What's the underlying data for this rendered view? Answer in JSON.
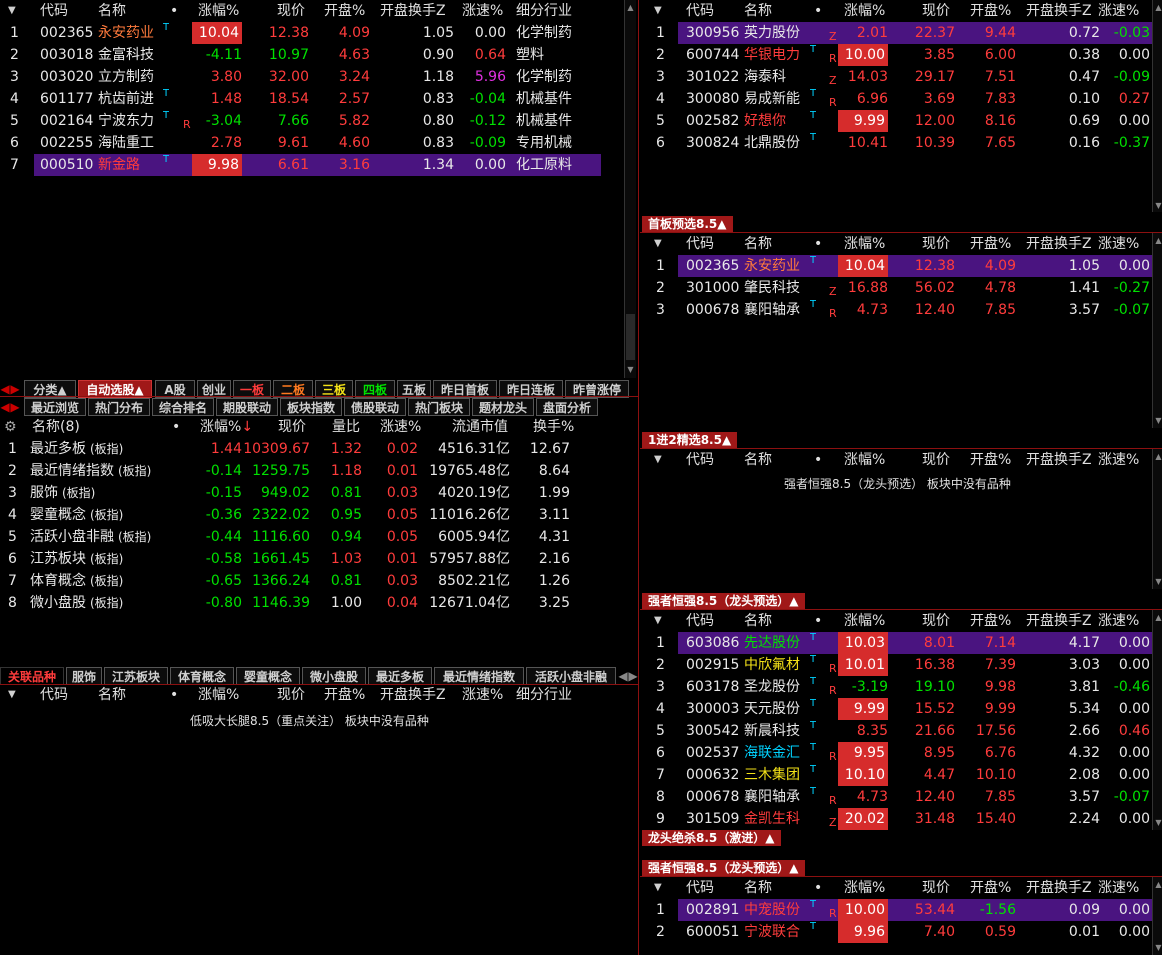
{
  "colors": {
    "red": "#ff3c3c",
    "green": "#00e000",
    "purple": "#4a1480",
    "box_red": "#d62c2c",
    "tab_red": "#a01818"
  },
  "icons": {
    "sort_toggle": "triangle-down-icon",
    "settings": "gear-icon",
    "scroll_up": "triangle-up-icon",
    "scroll_down": "triangle-down-icon"
  },
  "top_left": {
    "headers": [
      "代码",
      "名称",
      "•",
      "涨幅%",
      "现价",
      "开盘%",
      "开盘换手Z",
      "涨速%",
      "细分行业"
    ],
    "rows": [
      {
        "no": "1",
        "code": "002365",
        "name": "永安药业",
        "nc": "orange",
        "m": "",
        "t": "T",
        "chg": "10.04",
        "box": true,
        "price": "12.38",
        "open": "4.09",
        "turn": "1.05",
        "speed": "0.00",
        "ind": "化学制药",
        "pc": "red",
        "oc": "red",
        "sc": "white",
        "cc": "white"
      },
      {
        "no": "2",
        "code": "003018",
        "name": "金富科技",
        "nc": "white",
        "m": "",
        "t": "",
        "chg": "-4.11",
        "box": false,
        "price": "10.97",
        "open": "4.63",
        "turn": "0.90",
        "speed": "0.64",
        "ind": "塑料",
        "pc": "green",
        "oc": "red",
        "sc": "red",
        "cc": "green"
      },
      {
        "no": "3",
        "code": "003020",
        "name": "立方制药",
        "nc": "white",
        "m": "",
        "t": "",
        "chg": "3.80",
        "box": false,
        "price": "32.00",
        "open": "3.24",
        "turn": "1.18",
        "speed": "5.96",
        "ind": "化学制药",
        "pc": "red",
        "oc": "red",
        "sc": "magenta",
        "cc": "red"
      },
      {
        "no": "4",
        "code": "601177",
        "name": "杭齿前进",
        "nc": "white",
        "m": "",
        "t": "T",
        "chg": "1.48",
        "box": false,
        "price": "18.54",
        "open": "2.57",
        "turn": "0.83",
        "speed": "-0.04",
        "ind": "机械基件",
        "pc": "red",
        "oc": "red",
        "sc": "green",
        "cc": "red"
      },
      {
        "no": "5",
        "code": "002164",
        "name": "宁波东力",
        "nc": "white",
        "m": "R",
        "t": "T",
        "chg": "-3.04",
        "box": false,
        "price": "7.66",
        "open": "5.82",
        "turn": "0.80",
        "speed": "-0.12",
        "ind": "机械基件",
        "pc": "green",
        "oc": "red",
        "sc": "green",
        "cc": "green"
      },
      {
        "no": "6",
        "code": "002255",
        "name": "海陆重工",
        "nc": "white",
        "m": "",
        "t": "",
        "chg": "2.78",
        "box": false,
        "price": "9.61",
        "open": "4.60",
        "turn": "0.83",
        "speed": "-0.09",
        "ind": "专用机械",
        "pc": "red",
        "oc": "red",
        "sc": "green",
        "cc": "red"
      },
      {
        "no": "7",
        "code": "000510",
        "name": "新金路",
        "nc": "red",
        "m": "",
        "t": "T",
        "chg": "9.98",
        "box": true,
        "price": "6.61",
        "open": "3.16",
        "turn": "1.34",
        "speed": "0.00",
        "ind": "化工原料",
        "pc": "red",
        "oc": "red",
        "sc": "white",
        "cc": "white",
        "sel": true
      }
    ]
  },
  "tabs1": [
    "分类▲",
    "自动选股▲",
    "A股",
    "创业",
    "一板",
    "二板",
    "三板",
    "四板",
    "五板",
    "昨日首板",
    "昨日连板",
    "昨曾涨停"
  ],
  "tabs2": [
    "最近浏览",
    "热门分布",
    "综合排名",
    "期股联动",
    "板块指数",
    "债股联动",
    "热门板块",
    "题材龙头",
    "盘面分析"
  ],
  "sector": {
    "headers": [
      "名称(8)",
      "•",
      "涨幅%",
      "现价",
      "量比",
      "涨速%",
      "流通市值",
      "换手%"
    ],
    "rows": [
      {
        "no": "1",
        "name": "最近多板",
        "tag": "(板指)",
        "chg": "1.44",
        "price": "10309.67",
        "vr": "1.32",
        "speed": "0.02",
        "cap": "4516.31亿",
        "turn": "12.67",
        "cc": "red",
        "vc": "red"
      },
      {
        "no": "2",
        "name": "最近情绪指数",
        "tag": "(板指)",
        "chg": "-0.14",
        "price": "1259.75",
        "vr": "1.18",
        "speed": "0.01",
        "cap": "19765.48亿",
        "turn": "8.64",
        "cc": "green",
        "vc": "red"
      },
      {
        "no": "3",
        "name": "服饰",
        "tag": "(板指)",
        "chg": "-0.15",
        "price": "949.02",
        "vr": "0.81",
        "speed": "0.03",
        "cap": "4020.19亿",
        "turn": "1.99",
        "cc": "green",
        "vc": "green"
      },
      {
        "no": "4",
        "name": "婴童概念",
        "tag": "(板指)",
        "chg": "-0.36",
        "price": "2322.02",
        "vr": "0.95",
        "speed": "0.05",
        "cap": "11016.26亿",
        "turn": "3.11",
        "cc": "green",
        "vc": "green"
      },
      {
        "no": "5",
        "name": "活跃小盘非融",
        "tag": "(板指)",
        "chg": "-0.44",
        "price": "1116.60",
        "vr": "0.94",
        "speed": "0.05",
        "cap": "6005.94亿",
        "turn": "4.31",
        "cc": "green",
        "vc": "green"
      },
      {
        "no": "6",
        "name": "江苏板块",
        "tag": "(板指)",
        "chg": "-0.58",
        "price": "1661.45",
        "vr": "1.03",
        "speed": "0.01",
        "cap": "57957.88亿",
        "turn": "2.16",
        "cc": "green",
        "vc": "red"
      },
      {
        "no": "7",
        "name": "体育概念",
        "tag": "(板指)",
        "chg": "-0.65",
        "price": "1366.24",
        "vr": "0.81",
        "speed": "0.03",
        "cap": "8502.21亿",
        "turn": "1.26",
        "cc": "green",
        "vc": "green"
      },
      {
        "no": "8",
        "name": "微小盘股",
        "tag": "(板指)",
        "chg": "-0.80",
        "price": "1146.39",
        "vr": "1.00",
        "speed": "0.04",
        "cap": "12671.04亿",
        "turn": "3.25",
        "cc": "green",
        "vc": "white"
      }
    ]
  },
  "tabs3": [
    "关联品种",
    "服饰",
    "江苏板块",
    "体育概念",
    "婴童概念",
    "微小盘股",
    "最近多板",
    "最近情绪指数",
    "活跃小盘非融"
  ],
  "bottom_left": {
    "headers": [
      "代码",
      "名称",
      "•",
      "涨幅%",
      "现价",
      "开盘%",
      "开盘换手Z",
      "涨速%",
      "细分行业"
    ],
    "empty": "低吸大长腿8.5（重点关注） 板块中没有品种"
  },
  "right_headers": [
    "代码",
    "名称",
    "•",
    "涨幅%",
    "现价",
    "开盘%",
    "开盘换手Z",
    "涨速%"
  ],
  "r1": {
    "rows": [
      {
        "no": "1",
        "code": "300956",
        "name": "英力股份",
        "nc": "white",
        "m": "Z",
        "t": "",
        "chg": "2.01",
        "box": false,
        "price": "22.37",
        "open": "9.44",
        "turn": "0.72",
        "speed": "-0.03",
        "cc": "red",
        "pc": "red",
        "oc": "red",
        "sc": "green",
        "sel": true
      },
      {
        "no": "2",
        "code": "600744",
        "name": "华银电力",
        "nc": "red",
        "m": "R",
        "t": "T",
        "chg": "10.00",
        "box": true,
        "price": "3.85",
        "open": "6.00",
        "turn": "0.38",
        "speed": "0.00",
        "cc": "white",
        "pc": "red",
        "oc": "red",
        "sc": "white"
      },
      {
        "no": "3",
        "code": "301022",
        "name": "海泰科",
        "nc": "white",
        "m": "Z",
        "t": "",
        "chg": "14.03",
        "box": false,
        "price": "29.17",
        "open": "7.51",
        "turn": "0.47",
        "speed": "-0.09",
        "cc": "red",
        "pc": "red",
        "oc": "red",
        "sc": "green"
      },
      {
        "no": "4",
        "code": "300080",
        "name": "易成新能",
        "nc": "white",
        "m": "R",
        "t": "T",
        "chg": "6.96",
        "box": false,
        "price": "3.69",
        "open": "7.83",
        "turn": "0.10",
        "speed": "0.27",
        "cc": "red",
        "pc": "red",
        "oc": "red",
        "sc": "red"
      },
      {
        "no": "5",
        "code": "002582",
        "name": "好想你",
        "nc": "red",
        "m": "",
        "t": "T",
        "chg": "9.99",
        "box": true,
        "price": "12.00",
        "open": "8.16",
        "turn": "0.69",
        "speed": "0.00",
        "cc": "white",
        "pc": "red",
        "oc": "red",
        "sc": "white"
      },
      {
        "no": "6",
        "code": "300824",
        "name": "北鼎股份",
        "nc": "white",
        "m": "",
        "t": "T",
        "chg": "10.41",
        "box": false,
        "price": "10.39",
        "open": "7.65",
        "turn": "0.16",
        "speed": "-0.37",
        "cc": "red",
        "pc": "red",
        "oc": "red",
        "sc": "green"
      }
    ]
  },
  "r2": {
    "label": "首板预选8.5▲",
    "rows": [
      {
        "no": "1",
        "code": "002365",
        "name": "永安药业",
        "nc": "orange",
        "m": "",
        "t": "T",
        "chg": "10.04",
        "box": true,
        "price": "12.38",
        "open": "4.09",
        "turn": "1.05",
        "speed": "0.00",
        "cc": "white",
        "pc": "red",
        "oc": "red",
        "sc": "white",
        "sel": true
      },
      {
        "no": "2",
        "code": "301000",
        "name": "肇民科技",
        "nc": "white",
        "m": "Z",
        "t": "",
        "chg": "16.88",
        "box": false,
        "price": "56.02",
        "open": "4.78",
        "turn": "1.41",
        "speed": "-0.27",
        "cc": "red",
        "pc": "red",
        "oc": "red",
        "sc": "green"
      },
      {
        "no": "3",
        "code": "000678",
        "name": "襄阳轴承",
        "nc": "white",
        "m": "R",
        "t": "T",
        "chg": "4.73",
        "box": false,
        "price": "12.40",
        "open": "7.85",
        "turn": "3.57",
        "speed": "-0.07",
        "cc": "red",
        "pc": "red",
        "oc": "red",
        "sc": "green"
      }
    ]
  },
  "r3": {
    "label": "1进2精选8.5▲",
    "empty": "强者恒强8.5（龙头预选） 板块中没有品种"
  },
  "r4": {
    "label": "强者恒强8.5（龙头预选）▲",
    "rows": [
      {
        "no": "1",
        "code": "603086",
        "name": "先达股份",
        "nc": "green",
        "m": "",
        "t": "T",
        "chg": "10.03",
        "box": true,
        "price": "8.01",
        "open": "7.14",
        "turn": "4.17",
        "speed": "0.00",
        "cc": "white",
        "pc": "red",
        "oc": "red",
        "sc": "white",
        "sel": true
      },
      {
        "no": "2",
        "code": "002915",
        "name": "中欣氟材",
        "nc": "yellow",
        "m": "R",
        "t": "T",
        "chg": "10.01",
        "box": true,
        "price": "16.38",
        "open": "7.39",
        "turn": "3.03",
        "speed": "0.00",
        "cc": "white",
        "pc": "red",
        "oc": "red",
        "sc": "white"
      },
      {
        "no": "3",
        "code": "603178",
        "name": "圣龙股份",
        "nc": "white",
        "m": "R",
        "t": "T",
        "chg": "-3.19",
        "box": false,
        "price": "19.10",
        "open": "9.98",
        "turn": "3.81",
        "speed": "-0.46",
        "cc": "green",
        "pc": "green",
        "oc": "red",
        "sc": "green"
      },
      {
        "no": "4",
        "code": "300003",
        "name": "天元股份",
        "nc": "white",
        "m": "",
        "t": "T",
        "chg": "9.99",
        "box": true,
        "price": "15.52",
        "open": "9.99",
        "turn": "5.34",
        "speed": "0.00",
        "cc": "white",
        "pc": "red",
        "oc": "red",
        "sc": "white"
      },
      {
        "no": "5",
        "code": "300542",
        "name": "新晨科技",
        "nc": "white",
        "m": "",
        "t": "T",
        "chg": "8.35",
        "box": false,
        "price": "21.66",
        "open": "17.56",
        "turn": "2.66",
        "speed": "0.46",
        "cc": "red",
        "pc": "red",
        "oc": "red",
        "sc": "red"
      },
      {
        "no": "6",
        "code": "002537",
        "name": "海联金汇",
        "nc": "cyan",
        "m": "R",
        "t": "T",
        "chg": "9.95",
        "box": true,
        "price": "8.95",
        "open": "6.76",
        "turn": "4.32",
        "speed": "0.00",
        "cc": "white",
        "pc": "red",
        "oc": "red",
        "sc": "white"
      },
      {
        "no": "7",
        "code": "000632",
        "name": "三木集团",
        "nc": "yellow",
        "m": "",
        "t": "T",
        "chg": "10.10",
        "box": true,
        "price": "4.47",
        "open": "10.10",
        "turn": "2.08",
        "speed": "0.00",
        "cc": "white",
        "pc": "red",
        "oc": "red",
        "sc": "white"
      },
      {
        "no": "8",
        "code": "000678",
        "name": "襄阳轴承",
        "nc": "white",
        "m": "R",
        "t": "T",
        "chg": "4.73",
        "box": false,
        "price": "12.40",
        "open": "7.85",
        "turn": "3.57",
        "speed": "-0.07",
        "cc": "red",
        "pc": "red",
        "oc": "red",
        "sc": "green"
      },
      {
        "no": "9",
        "code": "301509",
        "name": "金凯生科",
        "nc": "red",
        "m": "Z",
        "t": "",
        "chg": "20.02",
        "box": true,
        "price": "31.48",
        "open": "15.40",
        "turn": "2.24",
        "speed": "0.00",
        "cc": "white",
        "pc": "red",
        "oc": "red",
        "sc": "white"
      }
    ],
    "sublabel": "龙头绝杀8.5（激进）▲"
  },
  "r5": {
    "label": "强者恒强8.5（龙头预选）▲",
    "rows": [
      {
        "no": "1",
        "code": "002891",
        "name": "中宠股份",
        "nc": "red",
        "m": "R",
        "t": "T",
        "chg": "10.00",
        "box": true,
        "price": "53.44",
        "open": "-1.56",
        "turn": "0.09",
        "speed": "0.00",
        "cc": "white",
        "pc": "red",
        "oc": "green",
        "sc": "white",
        "sel": true
      },
      {
        "no": "2",
        "code": "600051",
        "name": "宁波联合",
        "nc": "red",
        "m": "",
        "t": "T",
        "chg": "9.96",
        "box": true,
        "price": "7.40",
        "open": "0.59",
        "turn": "0.01",
        "speed": "0.00",
        "cc": "white",
        "pc": "red",
        "oc": "red",
        "sc": "white"
      }
    ]
  }
}
